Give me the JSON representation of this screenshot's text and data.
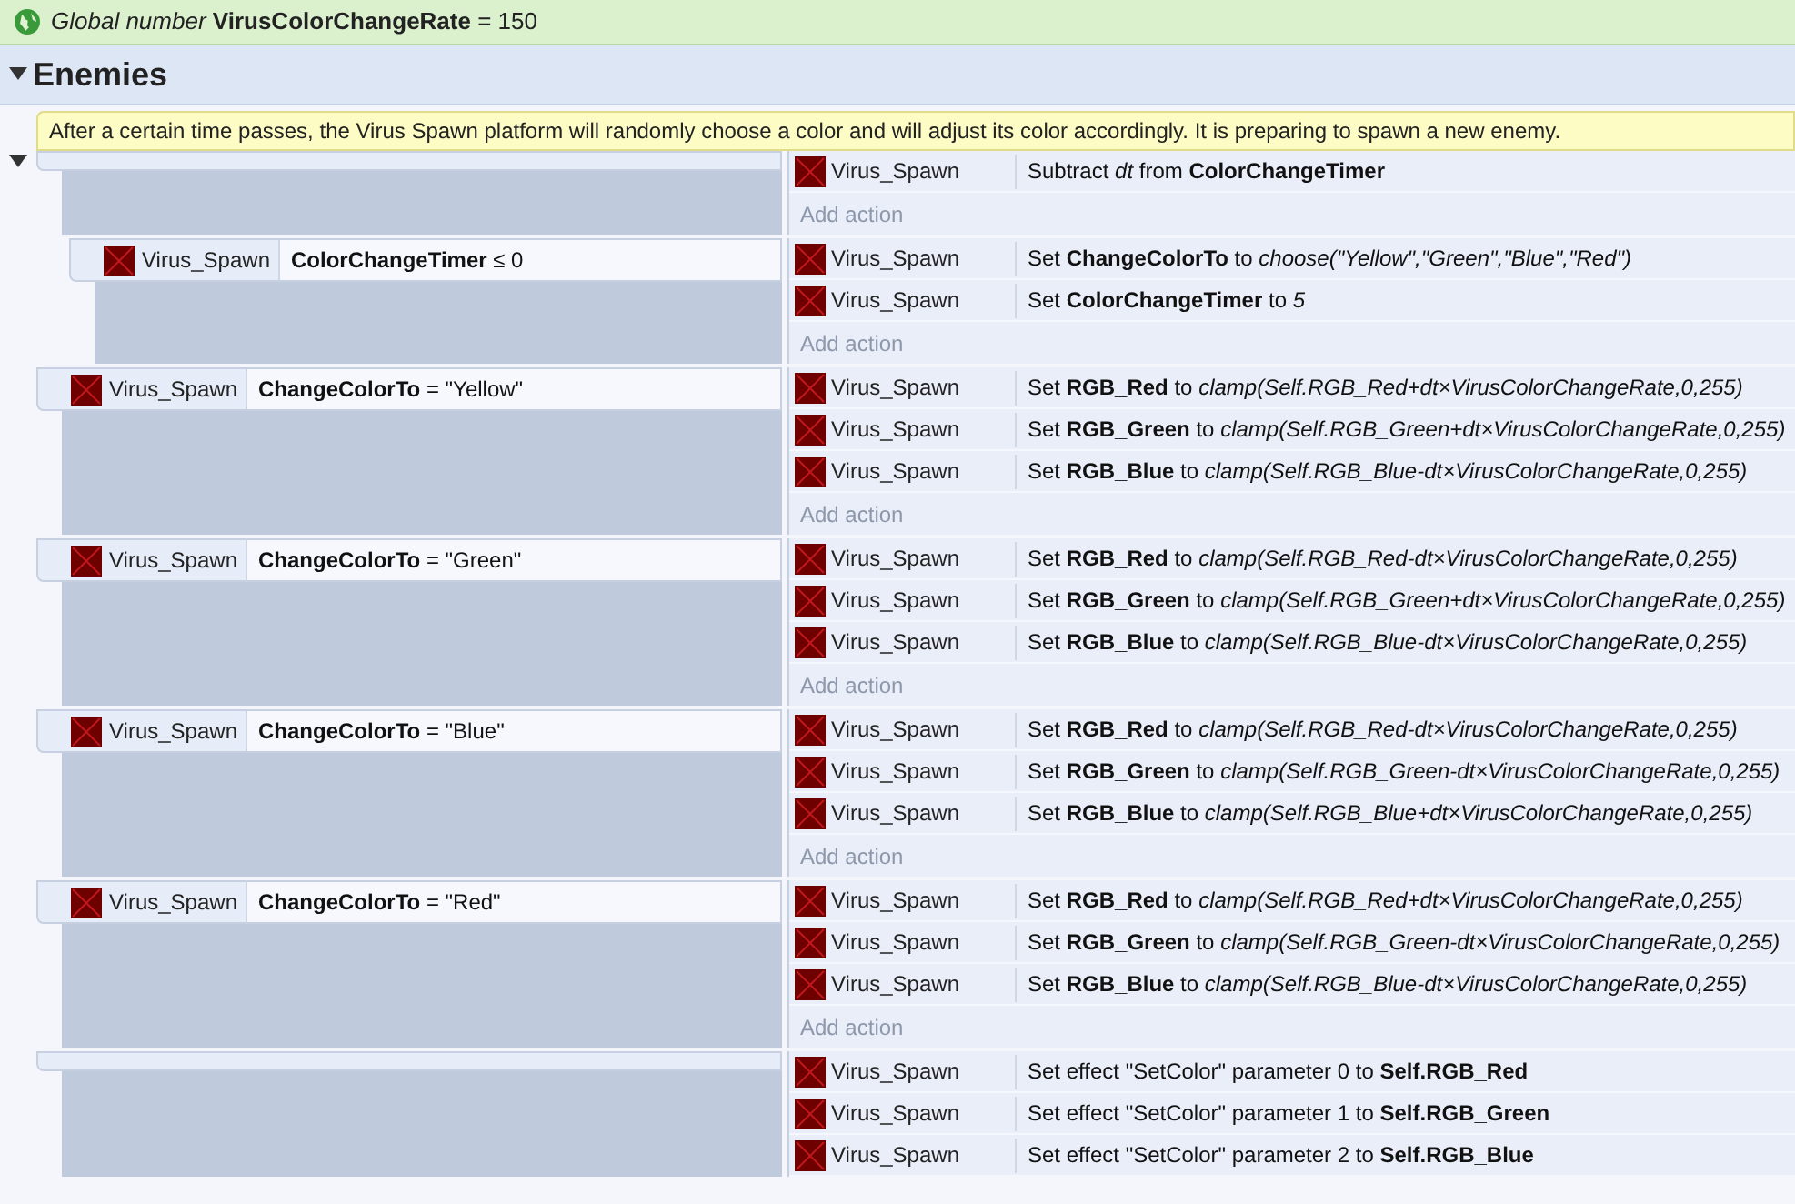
{
  "global_variable": {
    "text": "*Global number* **VirusColorChangeRate** = 150"
  },
  "group": {
    "title": "Enemies",
    "expanded": true,
    "comment": "After a certain time passes, the Virus Spawn platform will randomly choose a color and will adjust its color accordingly. It is preparing to spawn a new enemy.",
    "events": [
      {
        "expanded": true,
        "actions": [
          {
            "object": "Virus_Spawn",
            "text": "Subtract *dt* from **ColorChangeTimer**"
          }
        ],
        "add_action": "Add action",
        "children": [
          {
            "conditions": [
              {
                "object": "Virus_Spawn",
                "text": "**ColorChangeTimer** ≤ 0"
              }
            ],
            "actions": [
              {
                "object": "Virus_Spawn",
                "text": "Set **ChangeColorTo** to *choose(\"Yellow\",\"Green\",\"Blue\",\"Red\")*"
              },
              {
                "object": "Virus_Spawn",
                "text": "Set **ColorChangeTimer** to *5*"
              }
            ],
            "add_action": "Add action"
          }
        ]
      },
      {
        "conditions": [
          {
            "object": "Virus_Spawn",
            "text": "**ChangeColorTo** = \"Yellow\""
          }
        ],
        "actions": [
          {
            "object": "Virus_Spawn",
            "text": "Set **RGB_Red** to *clamp(Self.RGB_Red+dt×VirusColorChangeRate,0,255)*"
          },
          {
            "object": "Virus_Spawn",
            "text": "Set **RGB_Green** to *clamp(Self.RGB_Green+dt×VirusColorChangeRate,0,255)*"
          },
          {
            "object": "Virus_Spawn",
            "text": "Set **RGB_Blue** to *clamp(Self.RGB_Blue-dt×VirusColorChangeRate,0,255)*"
          }
        ],
        "add_action": "Add action"
      },
      {
        "conditions": [
          {
            "object": "Virus_Spawn",
            "text": "**ChangeColorTo** = \"Green\""
          }
        ],
        "actions": [
          {
            "object": "Virus_Spawn",
            "text": "Set **RGB_Red** to *clamp(Self.RGB_Red-dt×VirusColorChangeRate,0,255)*"
          },
          {
            "object": "Virus_Spawn",
            "text": "Set **RGB_Green** to *clamp(Self.RGB_Green+dt×VirusColorChangeRate,0,255)*"
          },
          {
            "object": "Virus_Spawn",
            "text": "Set **RGB_Blue** to *clamp(Self.RGB_Blue-dt×VirusColorChangeRate,0,255)*"
          }
        ],
        "add_action": "Add action"
      },
      {
        "conditions": [
          {
            "object": "Virus_Spawn",
            "text": "**ChangeColorTo** = \"Blue\""
          }
        ],
        "actions": [
          {
            "object": "Virus_Spawn",
            "text": "Set **RGB_Red** to *clamp(Self.RGB_Red-dt×VirusColorChangeRate,0,255)*"
          },
          {
            "object": "Virus_Spawn",
            "text": "Set **RGB_Green** to *clamp(Self.RGB_Green-dt×VirusColorChangeRate,0,255)*"
          },
          {
            "object": "Virus_Spawn",
            "text": "Set **RGB_Blue** to *clamp(Self.RGB_Blue+dt×VirusColorChangeRate,0,255)*"
          }
        ],
        "add_action": "Add action"
      },
      {
        "conditions": [
          {
            "object": "Virus_Spawn",
            "text": "**ChangeColorTo** = \"Red\""
          }
        ],
        "actions": [
          {
            "object": "Virus_Spawn",
            "text": "Set **RGB_Red** to *clamp(Self.RGB_Red+dt×VirusColorChangeRate,0,255)*"
          },
          {
            "object": "Virus_Spawn",
            "text": "Set **RGB_Green** to *clamp(Self.RGB_Green-dt×VirusColorChangeRate,0,255)*"
          },
          {
            "object": "Virus_Spawn",
            "text": "Set **RGB_Blue** to *clamp(Self.RGB_Blue-dt×VirusColorChangeRate,0,255)*"
          }
        ],
        "add_action": "Add action"
      },
      {
        "actions": [
          {
            "object": "Virus_Spawn",
            "text": "Set effect \"SetColor\" parameter 0 to **Self.RGB_Red**"
          },
          {
            "object": "Virus_Spawn",
            "text": "Set effect \"SetColor\" parameter 1 to **Self.RGB_Green**"
          },
          {
            "object": "Virus_Spawn",
            "text": "Set effect \"SetColor\" parameter 2 to **Self.RGB_Blue**"
          }
        ]
      }
    ]
  }
}
